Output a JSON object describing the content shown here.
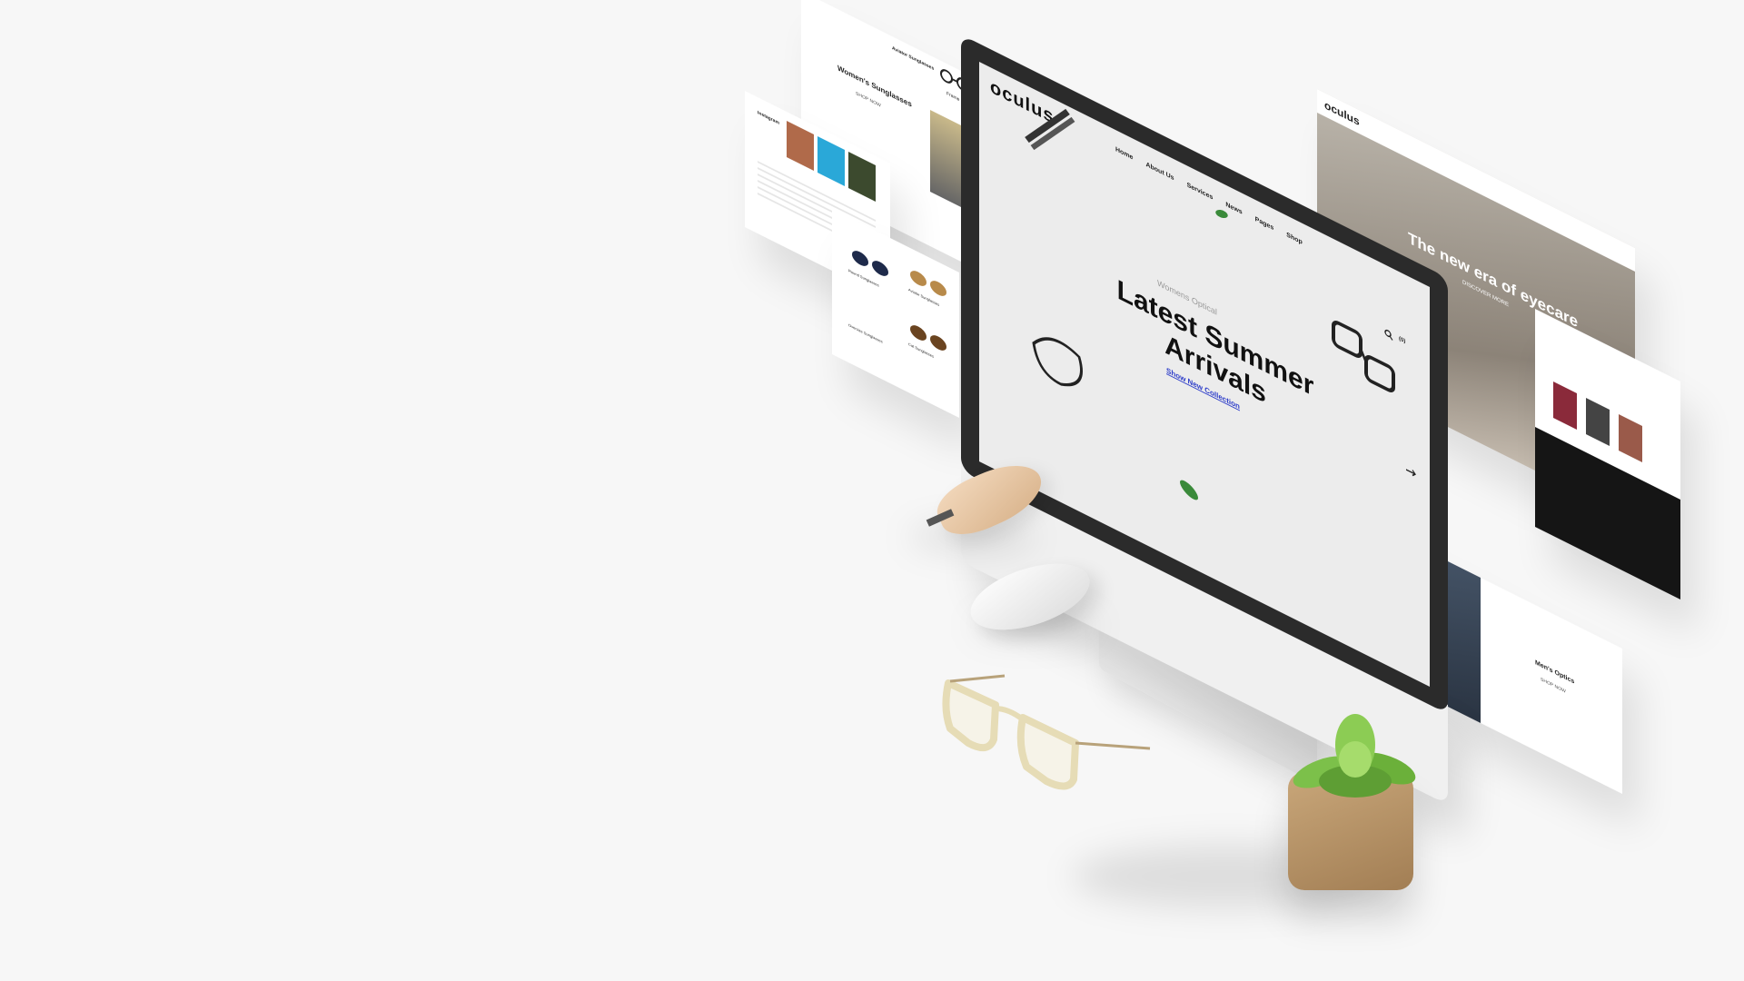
{
  "top_left_card": {
    "title": "Women's Sunglasses",
    "link": "SHOP NOW",
    "product_caption_1": "Aviator Sunglasses",
    "product_caption_2": "Frame"
  },
  "left_card": {
    "heading": "Instagram",
    "product_1": "Round Sunglasses",
    "product_2": "Aviator Sunglasses",
    "product_3": "Cat Sunglasses",
    "product_4": "Oversize Sunglasses"
  },
  "monitor_site": {
    "brand": "oculus",
    "menu": [
      "Home",
      "About Us",
      "Services",
      "News",
      "Pages",
      "Shop"
    ],
    "hero_subtitle": "Womens Optical",
    "hero_title_line1": "Latest Summer",
    "hero_title_line2": "Arrivals",
    "hero_link": "Show New Collection",
    "cart_label": "(0)"
  },
  "right_card": {
    "brand": "oculus",
    "hero_text": "The new era of eyecare",
    "hero_subtext": "DISCOVER MORE"
  },
  "bottom_right_card": {
    "title": "Men's Optics",
    "link": "SHOP NOW"
  },
  "colors": {
    "background": "#f7f7f7",
    "accent_link": "#2c3cc9",
    "bezel": "#2b2b2b"
  }
}
